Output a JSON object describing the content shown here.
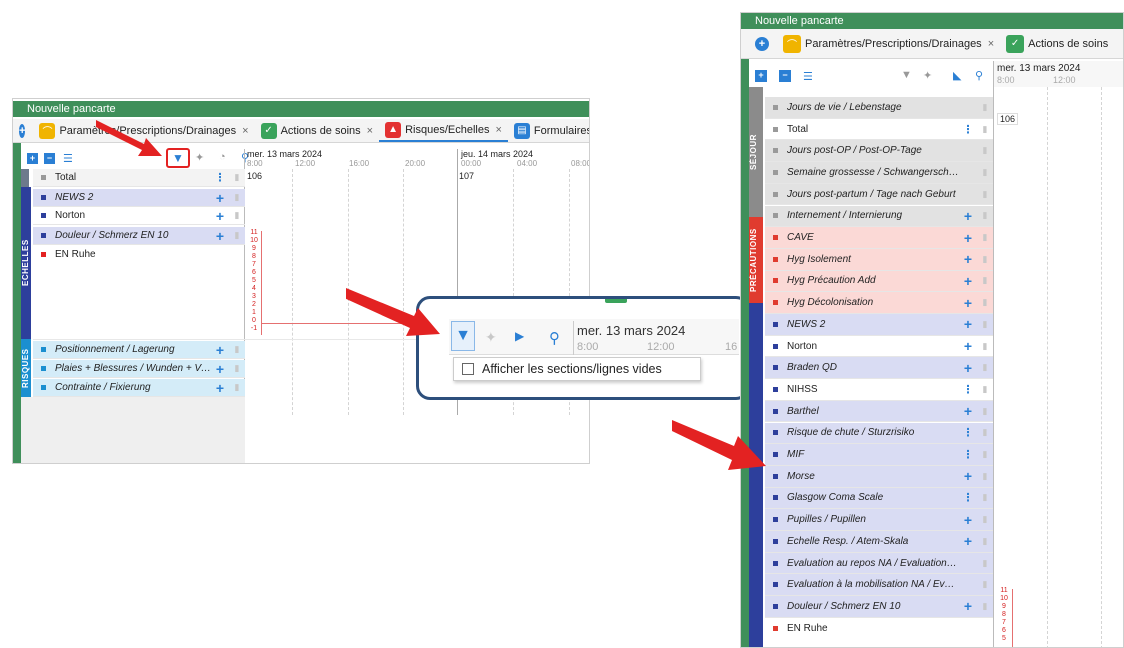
{
  "left_window": {
    "title": "Nouvelle pancarte",
    "tabs": [
      {
        "label": "Paramètres/Prescriptions/Drainages",
        "close": "×"
      },
      {
        "label": "Actions de soins",
        "close": "×"
      },
      {
        "label": "Risques/Echelles",
        "close": "×"
      },
      {
        "label": "Formulaires/De"
      }
    ],
    "date1": "mer. 13 mars 2024",
    "date2": "jeu. 14 mars 2024",
    "times1": [
      "8:00",
      "12:00",
      "16:00",
      "20:00"
    ],
    "times2": [
      "00:00",
      "04:00",
      "08:00"
    ],
    "total_label": "Total",
    "total_val1": "106",
    "total_val2": "107",
    "section_echelles": "ECHELLES",
    "section_risques": "RISQUES",
    "rows": [
      {
        "label": "NEWS 2"
      },
      {
        "label": "Norton"
      },
      {
        "label": "Douleur / Schmerz EN 10"
      },
      {
        "label": "EN Ruhe"
      },
      {
        "label": "Positionnement / Lagerung"
      },
      {
        "label": "Plaies + Blessures / Wunden + Ve..."
      },
      {
        "label": "Contrainte / Fixierung"
      }
    ],
    "pain_scale": [
      "11",
      "10",
      "9",
      "8",
      "7",
      "6",
      "5",
      "4",
      "3",
      "2",
      "1",
      "0",
      "-1"
    ]
  },
  "popup": {
    "date": "mer. 13 mars 2024",
    "times": [
      "8:00",
      "12:00",
      "16"
    ],
    "checkbox_label": "Afficher les sections/lignes vides"
  },
  "right_window": {
    "title": "Nouvelle pancarte",
    "tabs": [
      {
        "label": "Paramètres/Prescriptions/Drainages",
        "close": "×"
      },
      {
        "label": "Actions de soins"
      }
    ],
    "date": "mer. 13 mars 2024",
    "times": [
      "8:00",
      "12:00"
    ],
    "section_sejour": "SÉJOUR",
    "section_precautions": "PRÉCAUTIONS",
    "rows": [
      {
        "label": "Jours de vie / Lebenstage",
        "act": ""
      },
      {
        "label": "Total",
        "act": "⋮",
        "val": "106"
      },
      {
        "label": "Jours post-OP / Post-OP-Tage",
        "act": ""
      },
      {
        "label": "Semaine grossesse / Schwangerschafts...",
        "act": ""
      },
      {
        "label": "Jours post-partum / Tage nach Geburt",
        "act": ""
      },
      {
        "label": "Internement / Internierung",
        "act": "+"
      },
      {
        "label": "CAVE",
        "act": "+"
      },
      {
        "label": "Hyg Isolement",
        "act": "+"
      },
      {
        "label": "Hyg Précaution Add",
        "act": "+"
      },
      {
        "label": "Hyg Décolonisation",
        "act": "+"
      },
      {
        "label": "NEWS 2",
        "act": "+"
      },
      {
        "label": "Norton",
        "act": "+"
      },
      {
        "label": "Braden QD",
        "act": "+"
      },
      {
        "label": "NIHSS",
        "act": "⋮"
      },
      {
        "label": "Barthel",
        "act": "+"
      },
      {
        "label": "Risque de chute / Sturzrisiko",
        "act": "⋮"
      },
      {
        "label": "MIF",
        "act": "⋮"
      },
      {
        "label": "Morse",
        "act": "+"
      },
      {
        "label": "Glasgow Coma Scale",
        "act": "⋮"
      },
      {
        "label": "Pupilles / Pupillen",
        "act": "+"
      },
      {
        "label": "Echelle Resp. / Atem-Skala",
        "act": "+"
      },
      {
        "label": "Evaluation au repos NA / Evaluation b...",
        "act": ""
      },
      {
        "label": "Evaluation à la mobilisation NA / Eval...",
        "act": ""
      },
      {
        "label": "Douleur / Schmerz EN 10",
        "act": "+"
      },
      {
        "label": "EN Ruhe",
        "act": ""
      }
    ],
    "pain_scale": [
      "11",
      "10",
      "9",
      "8",
      "7",
      "6",
      "5"
    ]
  },
  "colors": {
    "green": "#3f8f5a",
    "blue": "#2a7fd4",
    "navy": "#2d3f9c",
    "echelle_bg": "#d9dcf3",
    "risque_bg": "#d4ecf8",
    "precaution_bg": "#fbd9d6",
    "sejour_bg": "#e2e2e2",
    "arrow_red": "#e32222"
  }
}
